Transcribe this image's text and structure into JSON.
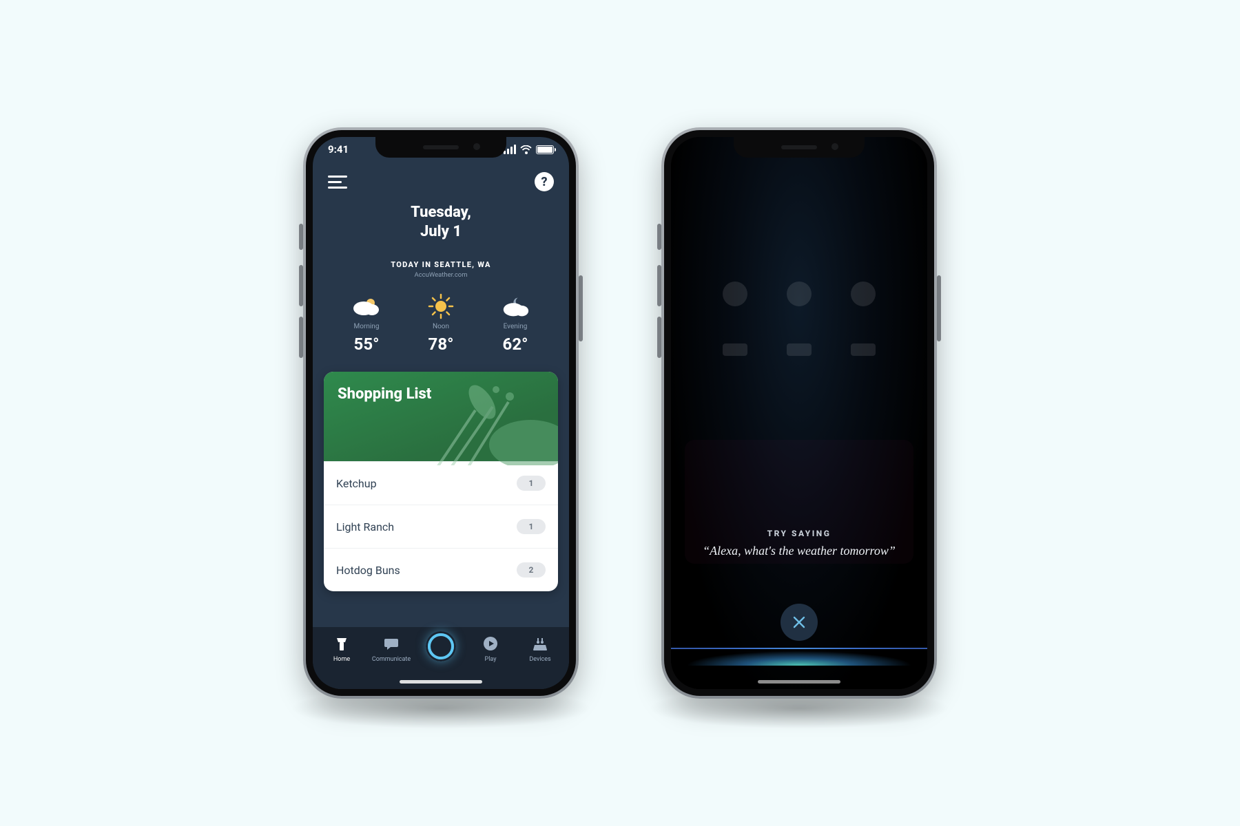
{
  "phone1": {
    "status": {
      "time": "9:41"
    },
    "header": {
      "date_line1": "Tuesday,",
      "date_line2": "July 1",
      "location": "TODAY IN SEATTLE, WA",
      "attribution": "AccuWeather.com"
    },
    "forecast": [
      {
        "label": "Morning",
        "temp": "55°",
        "icon": "partly-cloudy"
      },
      {
        "label": "Noon",
        "temp": "78°",
        "icon": "sunny"
      },
      {
        "label": "Evening",
        "temp": "62°",
        "icon": "night-cloudy"
      }
    ],
    "card": {
      "title": "Shopping List",
      "items": [
        {
          "name": "Ketchup",
          "count": "1"
        },
        {
          "name": "Light Ranch",
          "count": "1"
        },
        {
          "name": "Hotdog Buns",
          "count": "2"
        }
      ]
    },
    "tabs": [
      {
        "label": "Home"
      },
      {
        "label": "Communicate"
      },
      {
        "label": ""
      },
      {
        "label": "Play"
      },
      {
        "label": "Devices"
      }
    ],
    "help_glyph": "?"
  },
  "phone2": {
    "try_label": "TRY SAYING",
    "try_phrase": "“Alexa, what's the weather tomorrow”"
  }
}
